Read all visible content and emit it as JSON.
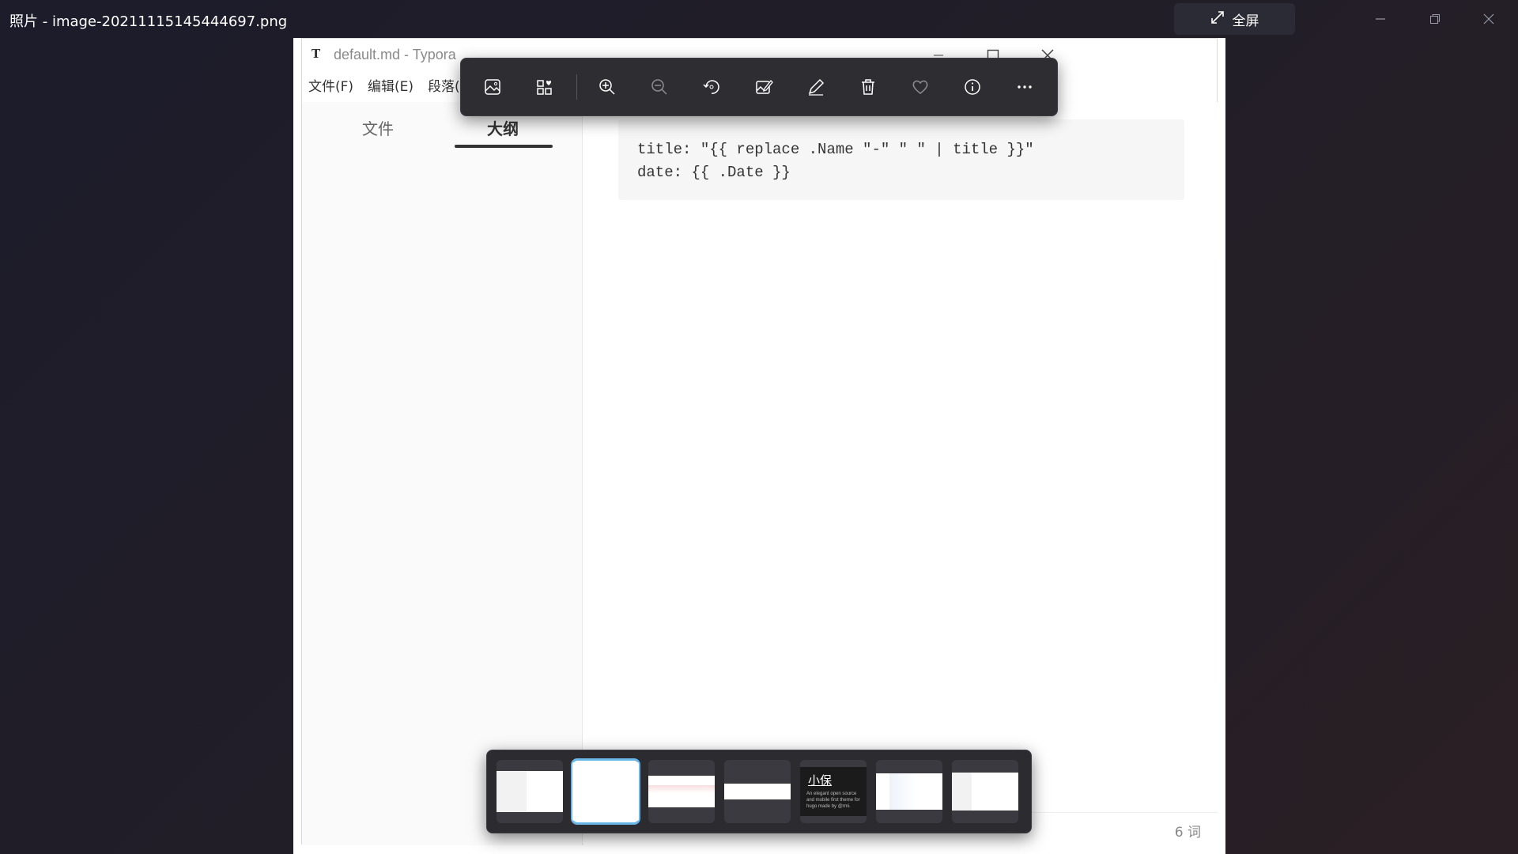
{
  "photos_app": {
    "title": "照片 - image-20211115145444697.png",
    "fullscreen_label": "全屏"
  },
  "typora": {
    "logo": "T",
    "window_title": "default.md - Typora",
    "menu": [
      "文件(F)",
      "编辑(E)",
      "段落("
    ],
    "sidebar": {
      "tab_files": "文件",
      "tab_outline": "大纲"
    },
    "code_block": "title: \"{{ replace .Name \"-\" \" \" | title }}\"\ndate: {{ .Date }}",
    "word_count": "6 词",
    "bottom_left": "<  </>"
  },
  "toolbar": {
    "buttons": [
      "edit-image",
      "add-to-album",
      "zoom-in",
      "zoom-out",
      "rotate",
      "edit-with-app",
      "draw",
      "delete",
      "favorite",
      "info",
      "more"
    ]
  },
  "filmstrip": {
    "selected_index": 1,
    "thumb_dark_label": "小保",
    "thumb_dark_subtext": "An elegant open source and mobile first theme for hugo made by @rmi."
  },
  "colors": {
    "accent": "#69b7e9",
    "toolbar_bg": "#2d2d32",
    "background": "#1f1c26"
  }
}
